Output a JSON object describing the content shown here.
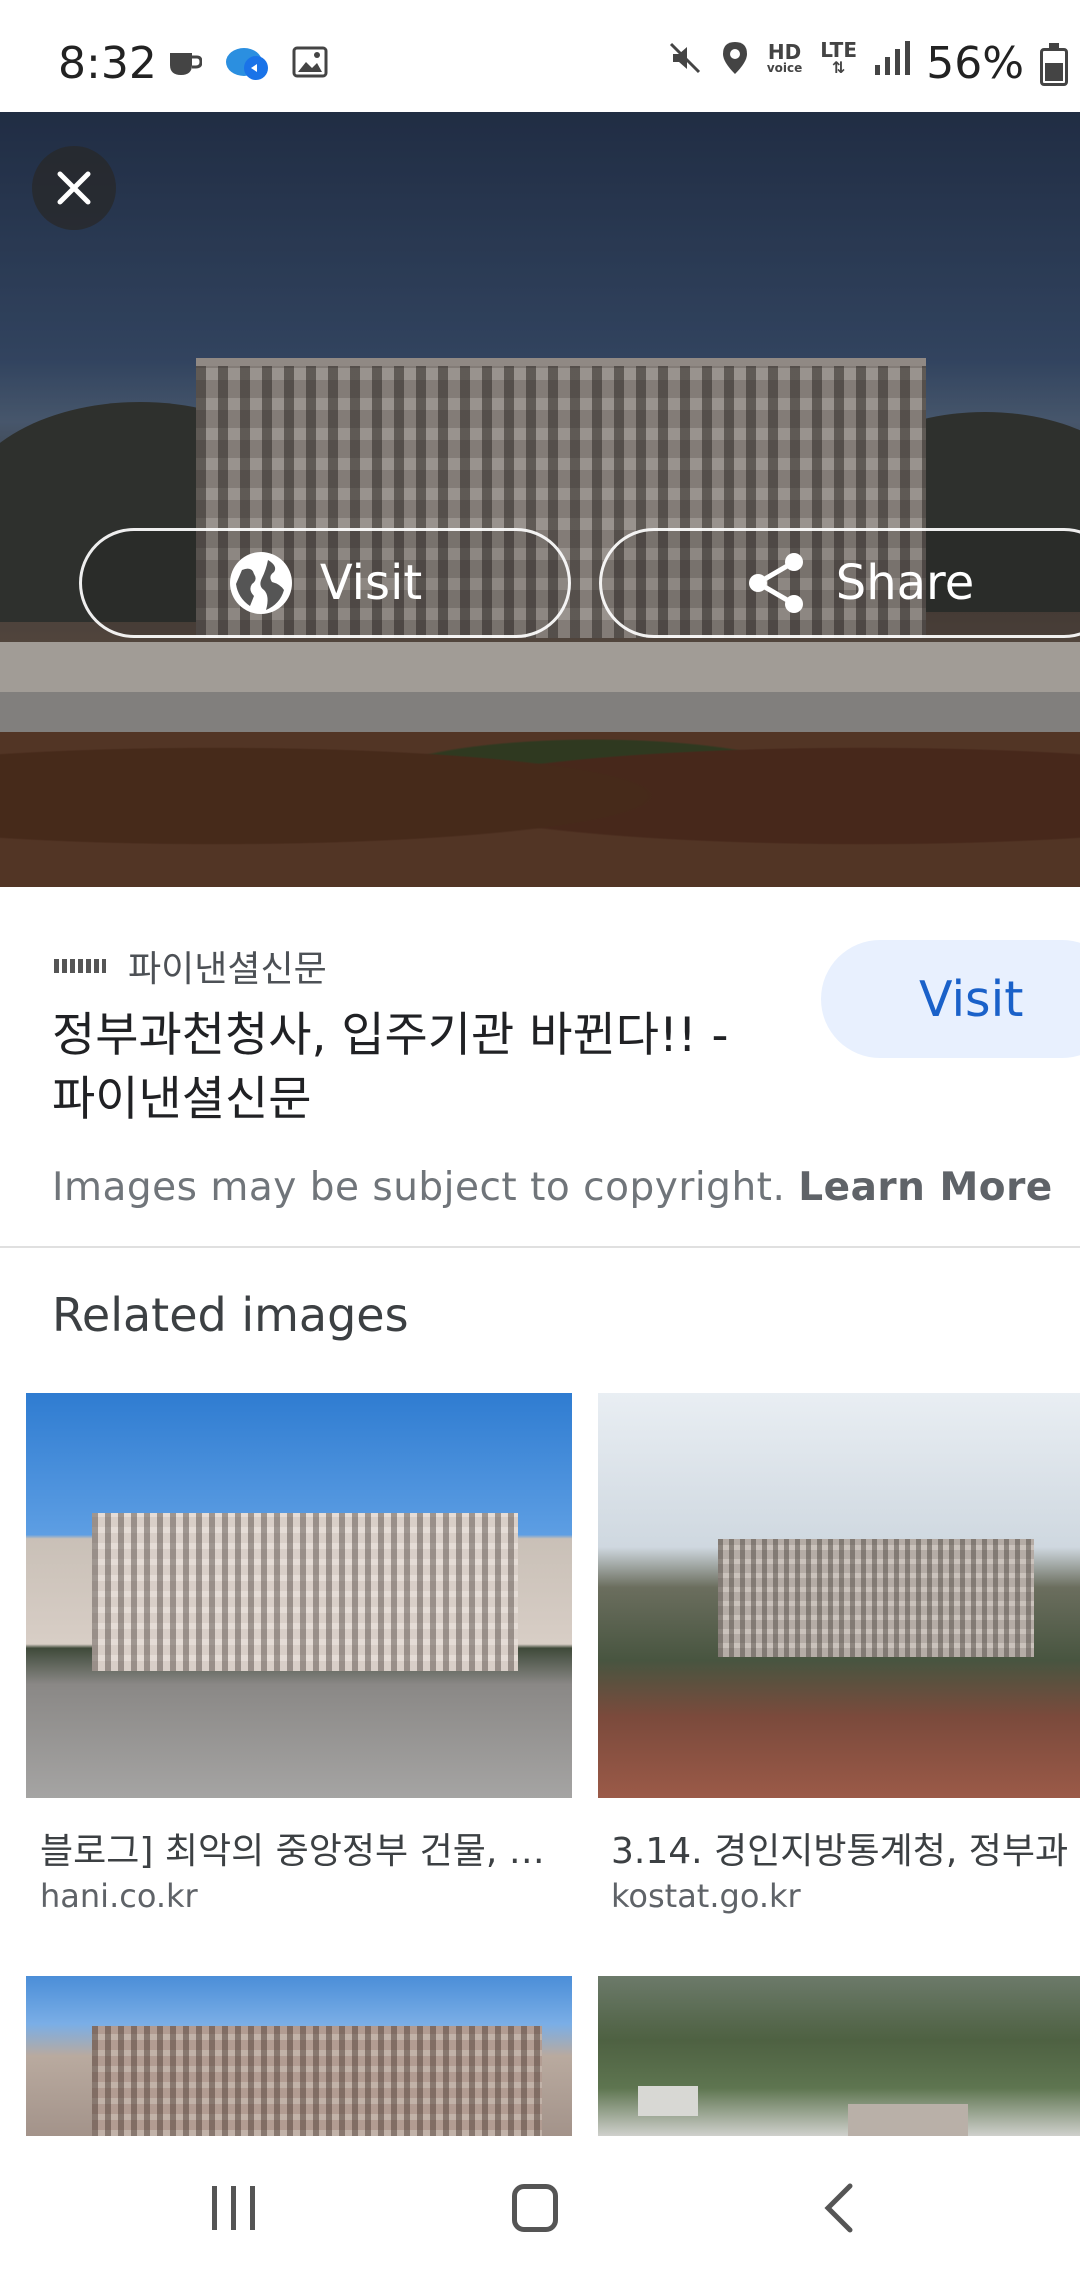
{
  "status_bar": {
    "time": "8:32",
    "battery_percent": "56%",
    "network_hd": "HD",
    "network_voice": "voice",
    "network_lte": "LTE",
    "icons": [
      "coffee-icon",
      "cloud-sync-icon",
      "gallery-icon",
      "mute-icon",
      "location-icon",
      "signal-icon",
      "battery-icon"
    ]
  },
  "hero": {
    "visit_label": "Visit",
    "share_label": "Share"
  },
  "result": {
    "source_name": "파이낸셜신문",
    "title": "정부과천청사, 입주기관 바뀐다!! - 파이낸셜신문",
    "visit_label": "Visit",
    "copyright_text": "Images may be subject to copyright.",
    "learn_more": "Learn More"
  },
  "related": {
    "heading": "Related images",
    "items": [
      {
        "caption": "블로그] 최악의 중앙정부 건물, …",
        "domain": "hani.co.kr"
      },
      {
        "caption": "3.14. 경인지방통계청, 정부과",
        "domain": "kostat.go.kr"
      },
      {
        "caption": "",
        "domain": ""
      },
      {
        "caption": "",
        "domain": ""
      }
    ]
  },
  "colors": {
    "accent_blue": "#1a61c9",
    "visit_bg": "#e8f0fe",
    "text_primary": "#202124",
    "text_secondary": "#70757a"
  }
}
